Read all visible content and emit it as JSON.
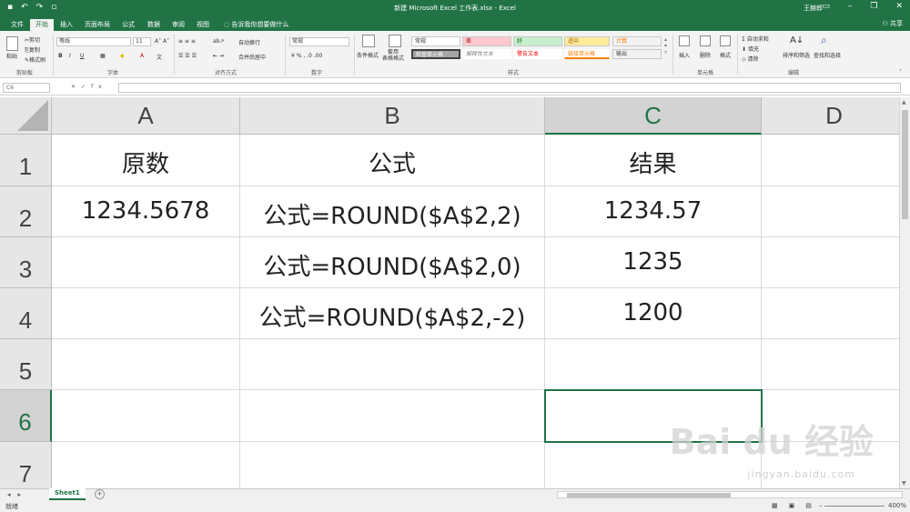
{
  "app": {
    "window_title": "新建 Microsoft Excel 工作表.xlsx  -  Excel",
    "user": "王赫郎",
    "share": "共享"
  },
  "ribbon_tabs": [
    "文件",
    "开始",
    "插入",
    "页面布局",
    "公式",
    "数据",
    "审阅",
    "视图"
  ],
  "tell_me": "告诉我你想要做什么",
  "ribbon": {
    "clipboard": {
      "paste": "粘贴",
      "cut": "剪切",
      "copy": "复制",
      "format_painter": "格式刷",
      "label": "剪贴板"
    },
    "font": {
      "name": "等线",
      "size": "11",
      "label": "字体"
    },
    "alignment": {
      "wrap": "自动换行",
      "merge": "合并后居中",
      "label": "对齐方式"
    },
    "number": {
      "format": "常规",
      "label": "数字"
    },
    "styles": {
      "conditional": "条件格式",
      "table": "套用\n表格格式",
      "cells": [
        "常规",
        "差",
        "好",
        "适中",
        "计算",
        "检查单元格",
        "解释性文本",
        "警告文本",
        "链接单元格",
        "输出"
      ],
      "label": "样式"
    },
    "cells_group": {
      "insert": "插入",
      "delete": "删除",
      "format": "格式",
      "label": "单元格"
    },
    "editing": {
      "autosum": "自动求和",
      "fill": "填充",
      "clear": "清除",
      "sort": "排序和筛选",
      "find": "查找和选择",
      "label": "编辑"
    }
  },
  "formula_bar": {
    "name_box": "C6",
    "content": ""
  },
  "columns": [
    "A",
    "B",
    "C",
    "D"
  ],
  "rows": [
    "1",
    "2",
    "3",
    "4",
    "5",
    "6",
    "7"
  ],
  "cells": {
    "A1": "原数",
    "B1": "公式",
    "C1": "结果",
    "A2": "1234.5678",
    "B2": "公式=ROUND($A$2,2)",
    "C2": "1234.57",
    "B3": "公式=ROUND($A$2,0)",
    "C3": "1235",
    "B4": "公式=ROUND($A$2,-2)",
    "C4": "1200"
  },
  "selected_cell": "C6",
  "sheet_tab": "Sheet1",
  "status": {
    "ready": "就绪",
    "zoom": "400%"
  },
  "watermark": {
    "main": "Bai du 经验",
    "sub": "jingyan.baidu.com"
  }
}
